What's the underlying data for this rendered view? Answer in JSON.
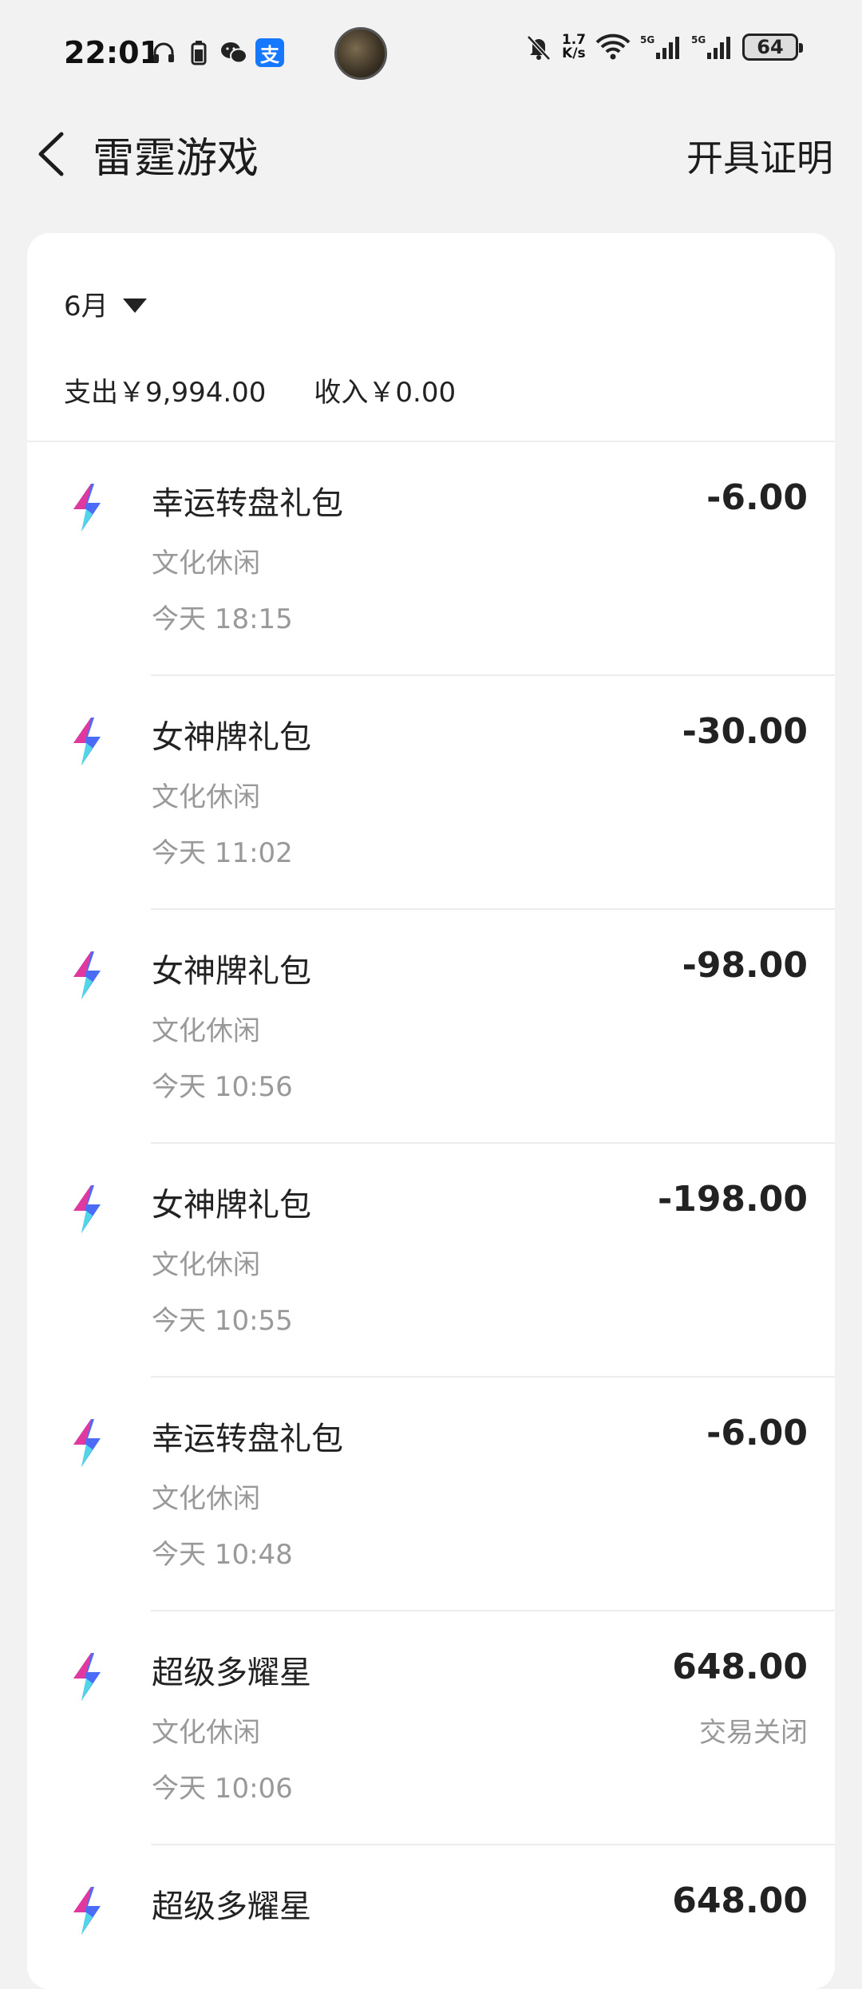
{
  "status_bar": {
    "time": "22:01",
    "net_speed_value": "1.7",
    "net_speed_unit": "K/s",
    "battery": "64",
    "icons": [
      "headphones-icon",
      "battery-saver-icon",
      "wechat-icon",
      "alipay-icon",
      "mute-bell-icon",
      "wifi-icon",
      "5g-signal-icon",
      "5g-signal-icon"
    ],
    "alipay_glyph": "支"
  },
  "header": {
    "title": "雷霆游戏",
    "action": "开具证明"
  },
  "summary": {
    "month": "6月",
    "expense": "支出￥9,994.00",
    "income": "收入￥0.00"
  },
  "transactions": [
    {
      "name": "幸运转盘礼包",
      "category": "文化休闲",
      "time": "今天 18:15",
      "amount": "-6.00",
      "status": ""
    },
    {
      "name": "女神牌礼包",
      "category": "文化休闲",
      "time": "今天 11:02",
      "amount": "-30.00",
      "status": ""
    },
    {
      "name": "女神牌礼包",
      "category": "文化休闲",
      "time": "今天 10:56",
      "amount": "-98.00",
      "status": ""
    },
    {
      "name": "女神牌礼包",
      "category": "文化休闲",
      "time": "今天 10:55",
      "amount": "-198.00",
      "status": ""
    },
    {
      "name": "幸运转盘礼包",
      "category": "文化休闲",
      "time": "今天 10:48",
      "amount": "-6.00",
      "status": ""
    },
    {
      "name": "超级多耀星",
      "category": "文化休闲",
      "time": "今天 10:06",
      "amount": "648.00",
      "status": "交易关闭"
    },
    {
      "name": "超级多耀星",
      "category": "",
      "time": "",
      "amount": "648.00",
      "status": ""
    }
  ],
  "colors": {
    "background": "#f2f2f2",
    "card": "#ffffff",
    "primary_text": "#222222",
    "secondary_text": "#999999",
    "icon_pink": "#e0389e",
    "icon_blue": "#4a6cf7",
    "icon_cyan": "#4fd6e8"
  }
}
